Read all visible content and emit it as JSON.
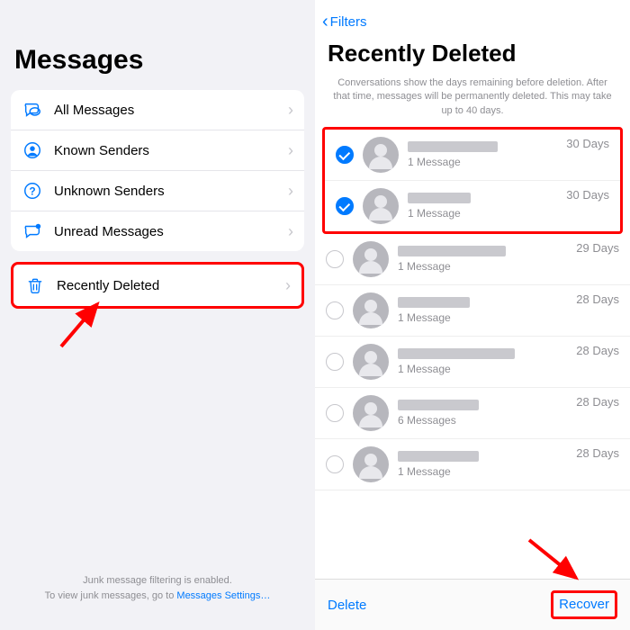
{
  "left": {
    "title": "Messages",
    "items": [
      {
        "label": "All Messages"
      },
      {
        "label": "Known Senders"
      },
      {
        "label": "Unknown Senders"
      },
      {
        "label": "Unread Messages"
      }
    ],
    "recently_deleted": "Recently Deleted",
    "footer1": "Junk message filtering is enabled.",
    "footer2": "To view junk messages, go to ",
    "footer_link": "Messages Settings…"
  },
  "right": {
    "back": "Filters",
    "title": "Recently Deleted",
    "note": "Conversations show the days remaining before deletion. After that time, messages will be permanently deleted. This may take up to 40 days.",
    "conversations": [
      {
        "selected": true,
        "name_w": 100,
        "sub": "1 Message",
        "days": "30 Days"
      },
      {
        "selected": true,
        "name_w": 70,
        "sub": "1 Message",
        "days": "30 Days"
      },
      {
        "selected": false,
        "name_w": 120,
        "sub": "1 Message",
        "days": "29 Days"
      },
      {
        "selected": false,
        "name_w": 80,
        "sub": "1 Message",
        "days": "28 Days"
      },
      {
        "selected": false,
        "name_w": 130,
        "sub": "1 Message",
        "days": "28 Days"
      },
      {
        "selected": false,
        "name_w": 90,
        "sub": "6 Messages",
        "days": "28 Days"
      },
      {
        "selected": false,
        "name_w": 90,
        "sub": "1 Message",
        "days": "28 Days"
      }
    ],
    "delete": "Delete",
    "recover": "Recover"
  }
}
